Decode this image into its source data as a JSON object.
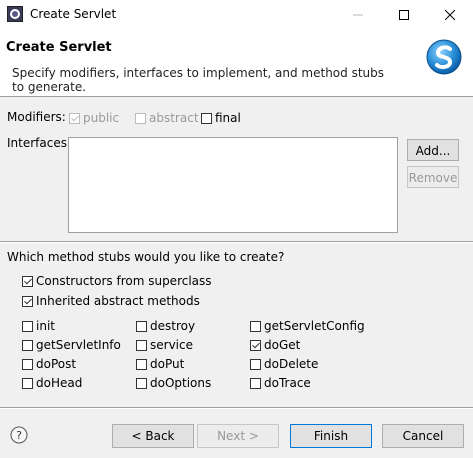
{
  "window": {
    "title": "Create Servlet",
    "minimize_icon": "minimize-icon",
    "maximize_icon": "maximize-icon",
    "close_icon": "close-icon"
  },
  "header": {
    "title": "Create Servlet",
    "description": "Specify modifiers, interfaces to implement, and method stubs to generate.",
    "icon": "servlet-wizard-icon"
  },
  "modifiers": {
    "label": "Modifiers:",
    "public": {
      "label": "public",
      "checked": true,
      "enabled": false
    },
    "abstract": {
      "label": "abstract",
      "checked": false,
      "enabled": false
    },
    "final": {
      "label": "final",
      "checked": false,
      "enabled": true
    }
  },
  "interfaces": {
    "label": "Interfaces:",
    "items": [],
    "add_label": "Add...",
    "remove_label": "Remove"
  },
  "stubs": {
    "question": "Which method stubs would you like to create?",
    "constructors": {
      "label": "Constructors from superclass",
      "checked": true
    },
    "inherited": {
      "label": "Inherited abstract methods",
      "checked": true
    },
    "methods": [
      {
        "label": "init",
        "checked": false
      },
      {
        "label": "destroy",
        "checked": false
      },
      {
        "label": "getServletConfig",
        "checked": false
      },
      {
        "label": "getServletInfo",
        "checked": false
      },
      {
        "label": "service",
        "checked": false
      },
      {
        "label": "doGet",
        "checked": true
      },
      {
        "label": "doPost",
        "checked": false
      },
      {
        "label": "doPut",
        "checked": false
      },
      {
        "label": "doDelete",
        "checked": false
      },
      {
        "label": "doHead",
        "checked": false
      },
      {
        "label": "doOptions",
        "checked": false
      },
      {
        "label": "doTrace",
        "checked": false
      }
    ]
  },
  "footer": {
    "help_icon": "help-icon",
    "back_label": "< Back",
    "next_label": "Next >",
    "finish_label": "Finish",
    "cancel_label": "Cancel"
  }
}
